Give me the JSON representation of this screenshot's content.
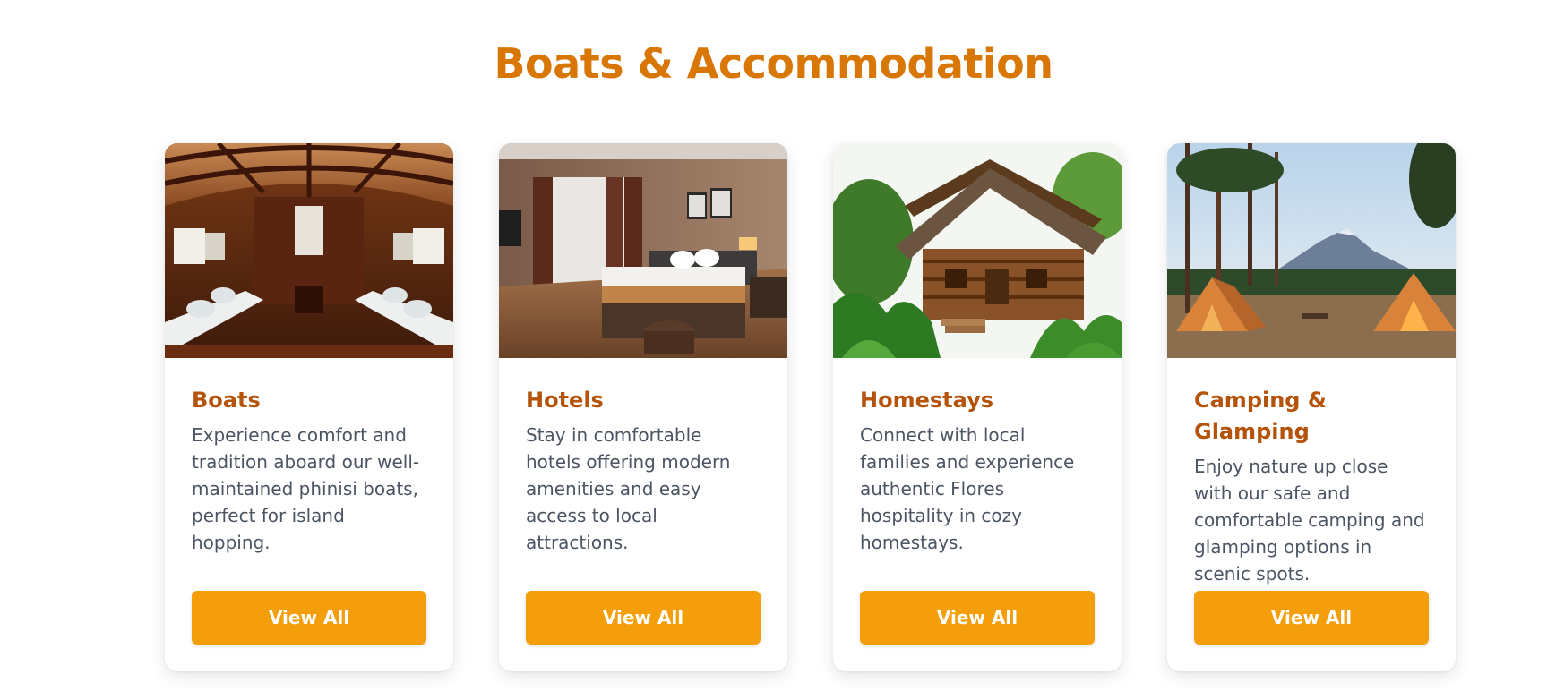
{
  "section": {
    "title": "Boats & Accommodation"
  },
  "cards": [
    {
      "title": "Boats",
      "description": "Experience comfort and tradition aboard our well-maintained phinisi boats, perfect for island hopping.",
      "button": "View All"
    },
    {
      "title": "Hotels",
      "description": "Stay in comfortable hotels offering modern amenities and easy access to local attractions.",
      "button": "View All"
    },
    {
      "title": "Homestays",
      "description": "Connect with local families and experience authentic Flores hospitality in cozy homestays.",
      "button": "View All"
    },
    {
      "title": "Camping & Glamping",
      "description": "Enjoy nature up close with our safe and comfortable camping and glamping options in scenic spots.",
      "button": "View All"
    }
  ],
  "colors": {
    "heading": "#d97706",
    "card_title": "#b45309",
    "button": "#f59e0b",
    "body_text": "#4b5563"
  }
}
